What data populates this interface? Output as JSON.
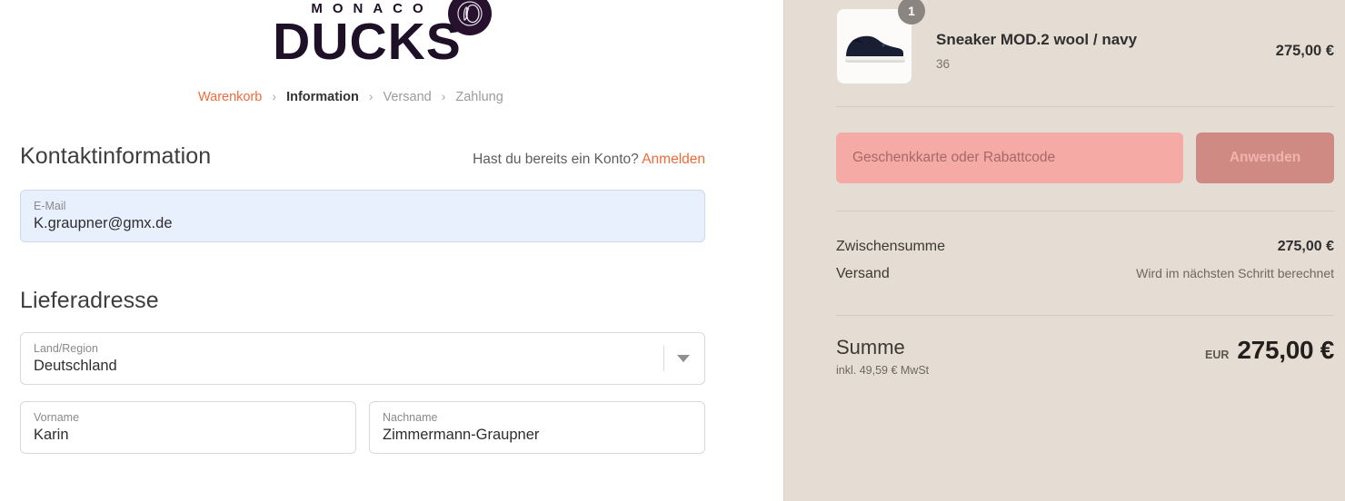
{
  "brand": {
    "top_text": "MONACO",
    "main_text": "DUCKS",
    "badge_icon": "duck-monogram-icon"
  },
  "breadcrumb": {
    "items": [
      {
        "label": "Warenkorb",
        "state": "link"
      },
      {
        "label": "Information",
        "state": "current"
      },
      {
        "label": "Versand",
        "state": "muted"
      },
      {
        "label": "Zahlung",
        "state": "muted"
      }
    ],
    "separator": "›"
  },
  "contact": {
    "title": "Kontaktinformation",
    "account_question": "Hast du bereits ein Konto?",
    "login_link": "Anmelden",
    "email": {
      "label": "E-Mail",
      "value": "K.graupner@gmx.de"
    }
  },
  "shipping": {
    "title": "Lieferadresse",
    "country": {
      "label": "Land/Region",
      "value": "Deutschland"
    },
    "first_name": {
      "label": "Vorname",
      "value": "Karin"
    },
    "last_name": {
      "label": "Nachname",
      "value": "Zimmermann-Graupner"
    }
  },
  "summary": {
    "item": {
      "title": "Sneaker MOD.2 wool / navy",
      "variant": "36",
      "quantity": "1",
      "price": "275,00 €",
      "image_icon": "navy-sneaker-thumbnail"
    },
    "discount": {
      "placeholder": "Geschenkkarte oder Rabattcode",
      "value": "",
      "apply_label": "Anwenden"
    },
    "subtotal": {
      "label": "Zwischensumme",
      "value": "275,00 €"
    },
    "shipping_cost": {
      "label": "Versand",
      "value": "Wird im nächsten Schritt berechnet"
    },
    "total": {
      "label": "Summe",
      "tax_note": "inkl. 49,59 € MwSt",
      "currency": "EUR",
      "amount": "275,00 €"
    }
  },
  "colors": {
    "accent_orange": "#ee6b3b",
    "panel_beige": "#e5ddd3",
    "brand_dark": "#1d1027",
    "discount_pink": "#f5aaa5",
    "apply_button": "#d08a84",
    "autofill_blue": "#e8f0fd"
  }
}
